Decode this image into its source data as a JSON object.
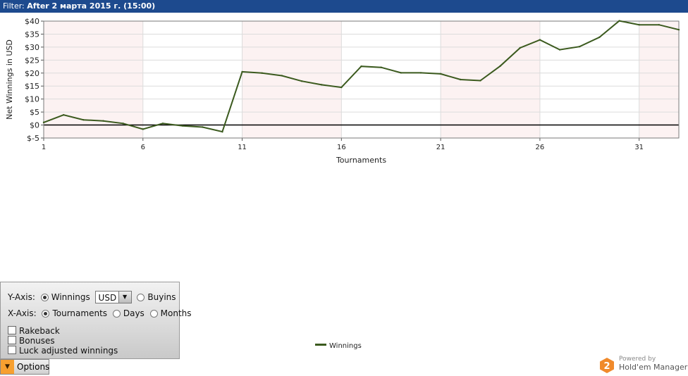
{
  "filter": {
    "prefix": "Filter: ",
    "value": "After 2 марта 2015 г. (15:00)"
  },
  "chart_data": {
    "type": "line",
    "xlabel": "Tournaments",
    "ylabel": "Net Winnings in USD",
    "x_ticks": [
      1,
      6,
      11,
      16,
      21,
      26,
      31
    ],
    "y_ticks": [
      -5,
      0,
      5,
      10,
      15,
      20,
      25,
      30,
      35,
      40
    ],
    "y_tick_labels": [
      "$-5",
      "$0",
      "$5",
      "$10",
      "$15",
      "$20",
      "$25",
      "$30",
      "$35",
      "$40"
    ],
    "xlim": [
      1,
      33
    ],
    "ylim": [
      -5,
      40
    ],
    "grid": true,
    "legend": "bottom-center",
    "series": [
      {
        "name": "Winnings",
        "color": "#3b5a1e",
        "x": [
          1,
          2,
          3,
          4,
          5,
          6,
          7,
          8,
          9,
          10,
          11,
          12,
          13,
          14,
          15,
          16,
          17,
          18,
          19,
          20,
          21,
          22,
          23,
          24,
          25,
          26,
          27,
          28,
          29,
          30,
          31,
          32,
          33
        ],
        "values": [
          1.0,
          3.9,
          2.0,
          1.6,
          0.6,
          -1.6,
          0.6,
          -0.3,
          -0.8,
          -2.6,
          20.5,
          20.0,
          19.0,
          16.9,
          15.5,
          14.5,
          22.6,
          22.2,
          20.1,
          20.1,
          19.7,
          17.5,
          17.1,
          22.7,
          29.7,
          32.8,
          29.0,
          30.2,
          33.8,
          40.1,
          38.6,
          38.6,
          36.7
        ]
      }
    ]
  },
  "options_panel": {
    "y_axis_label": "Y-Axis:",
    "winnings_label": "Winnings",
    "currency_value": "USD",
    "buyins_label": "Buyins",
    "x_axis_label": "X-Axis:",
    "tournaments_label": "Tournaments",
    "days_label": "Days",
    "months_label": "Months",
    "rakeback_label": "Rakeback",
    "bonuses_label": "Bonuses",
    "luck_label": "Luck adjusted winnings"
  },
  "options_button": {
    "label": "Options"
  },
  "brand": {
    "badge": "2",
    "powered": "Powered by",
    "name": "Hold'em Manager"
  }
}
